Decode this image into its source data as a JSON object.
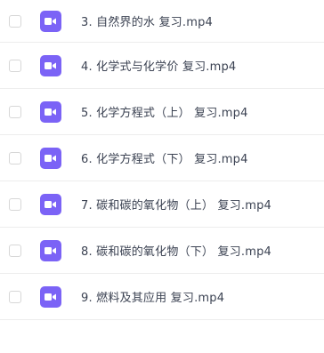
{
  "files": [
    {
      "name": "3. 自然界的水 复习.mp4",
      "type_icon": "video-file-icon"
    },
    {
      "name": "4. 化学式与化学价 复习.mp4",
      "type_icon": "video-file-icon"
    },
    {
      "name": "5. 化学方程式（上） 复习.mp4",
      "type_icon": "video-file-icon"
    },
    {
      "name": "6. 化学方程式（下） 复习.mp4",
      "type_icon": "video-file-icon"
    },
    {
      "name": "7. 碳和碳的氧化物（上） 复习.mp4",
      "type_icon": "video-file-icon"
    },
    {
      "name": "8. 碳和碳的氧化物（下） 复习.mp4",
      "type_icon": "video-file-icon"
    },
    {
      "name": "9. 燃料及其应用 复习.mp4",
      "type_icon": "video-file-icon"
    }
  ],
  "colors": {
    "icon_bg": "#7b63f6",
    "text": "#3b4252",
    "divider": "#ededed",
    "checkbox_border": "#d7d7d7"
  }
}
